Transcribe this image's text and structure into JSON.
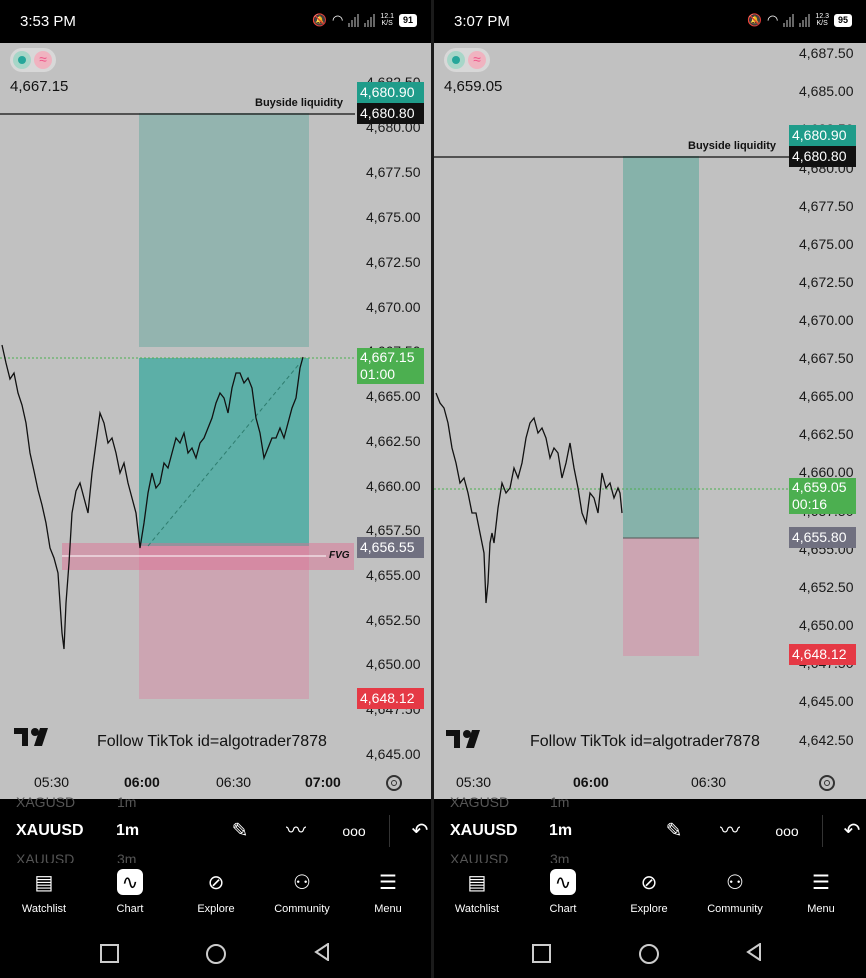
{
  "panels": [
    {
      "status": {
        "time": "3:53 PM",
        "speed_top": "12.1",
        "speed_bottom": "K/S",
        "battery": "91"
      },
      "chart": {
        "current_price": "4,667.15",
        "yaxis_labels": [
          "4,682.50",
          "4,680.00",
          "4,677.50",
          "4,675.00",
          "4,672.50",
          "4,670.00",
          "4,667.50",
          "4,665.00",
          "4,662.50",
          "4,660.00",
          "4,657.50",
          "4,655.00",
          "4,652.50",
          "4,650.00",
          "4,647.50",
          "4,645.00"
        ],
        "tags": {
          "target": "4,680.90",
          "buyside": "4,680.80",
          "price": "4,667.15",
          "countdown": "01:00",
          "entry": "4,656.55",
          "stop": "4,648.12"
        },
        "annotations": {
          "buyside_label": "Buyside liquidity",
          "fvg_label": "FVG"
        },
        "watermark": "Follow TikTok id=algotrader7878",
        "time_labels": [
          "05:30",
          "06:00",
          "06:30",
          "07:00"
        ]
      },
      "toolbar": {
        "ghost_symbol_top": "XAGUSD",
        "ghost_tf_top": "1m",
        "symbol": "XAUUSD",
        "timeframe": "1m",
        "ghost_symbol_bottom": "XAUUSD",
        "ghost_tf_bottom": "3m"
      }
    },
    {
      "status": {
        "time": "3:07 PM",
        "speed_top": "12.3",
        "speed_bottom": "K/S",
        "battery": "95"
      },
      "chart": {
        "current_price": "4,659.05",
        "yaxis_labels": [
          "4,687.50",
          "4,685.00",
          "4,682.50",
          "4,680.00",
          "4,677.50",
          "4,675.00",
          "4,672.50",
          "4,670.00",
          "4,667.50",
          "4,665.00",
          "4,662.50",
          "4,660.00",
          "4,657.50",
          "4,655.00",
          "4,652.50",
          "4,650.00",
          "4,647.50",
          "4,645.00",
          "4,642.50"
        ],
        "tags": {
          "target": "4,680.90",
          "buyside": "4,680.80",
          "price": "4,659.05",
          "countdown": "00:16",
          "entry": "4,655.80",
          "stop": "4,648.12"
        },
        "annotations": {
          "buyside_label": "Buyside liquidity"
        },
        "watermark": "Follow TikTok id=algotrader7878",
        "time_labels": [
          "05:30",
          "06:00",
          "06:30"
        ]
      },
      "toolbar": {
        "ghost_symbol_top": "XAGUSD",
        "ghost_tf_top": "1m",
        "symbol": "XAUUSD",
        "timeframe": "1m",
        "ghost_symbol_bottom": "XAUUSD",
        "ghost_tf_bottom": "3m"
      }
    }
  ],
  "bottom_nav": [
    "Watchlist",
    "Chart",
    "Explore",
    "Community",
    "Menu"
  ],
  "icons": {
    "toolbar": [
      "pencil-icon",
      "indicators-icon",
      "more-icon",
      "undo-icon"
    ],
    "nav": [
      "watchlist-icon",
      "chart-icon",
      "explore-icon",
      "community-icon",
      "menu-icon"
    ],
    "system": [
      "recents-icon",
      "home-icon",
      "back-icon"
    ]
  },
  "colors": {
    "profit_zone": "#26a69a",
    "loss_zone": "#ef5388",
    "price_tag": "#4caf50",
    "target_tag": "#1f9c8a",
    "stop_tag": "#e53945",
    "entry_tag": "#707080"
  }
}
